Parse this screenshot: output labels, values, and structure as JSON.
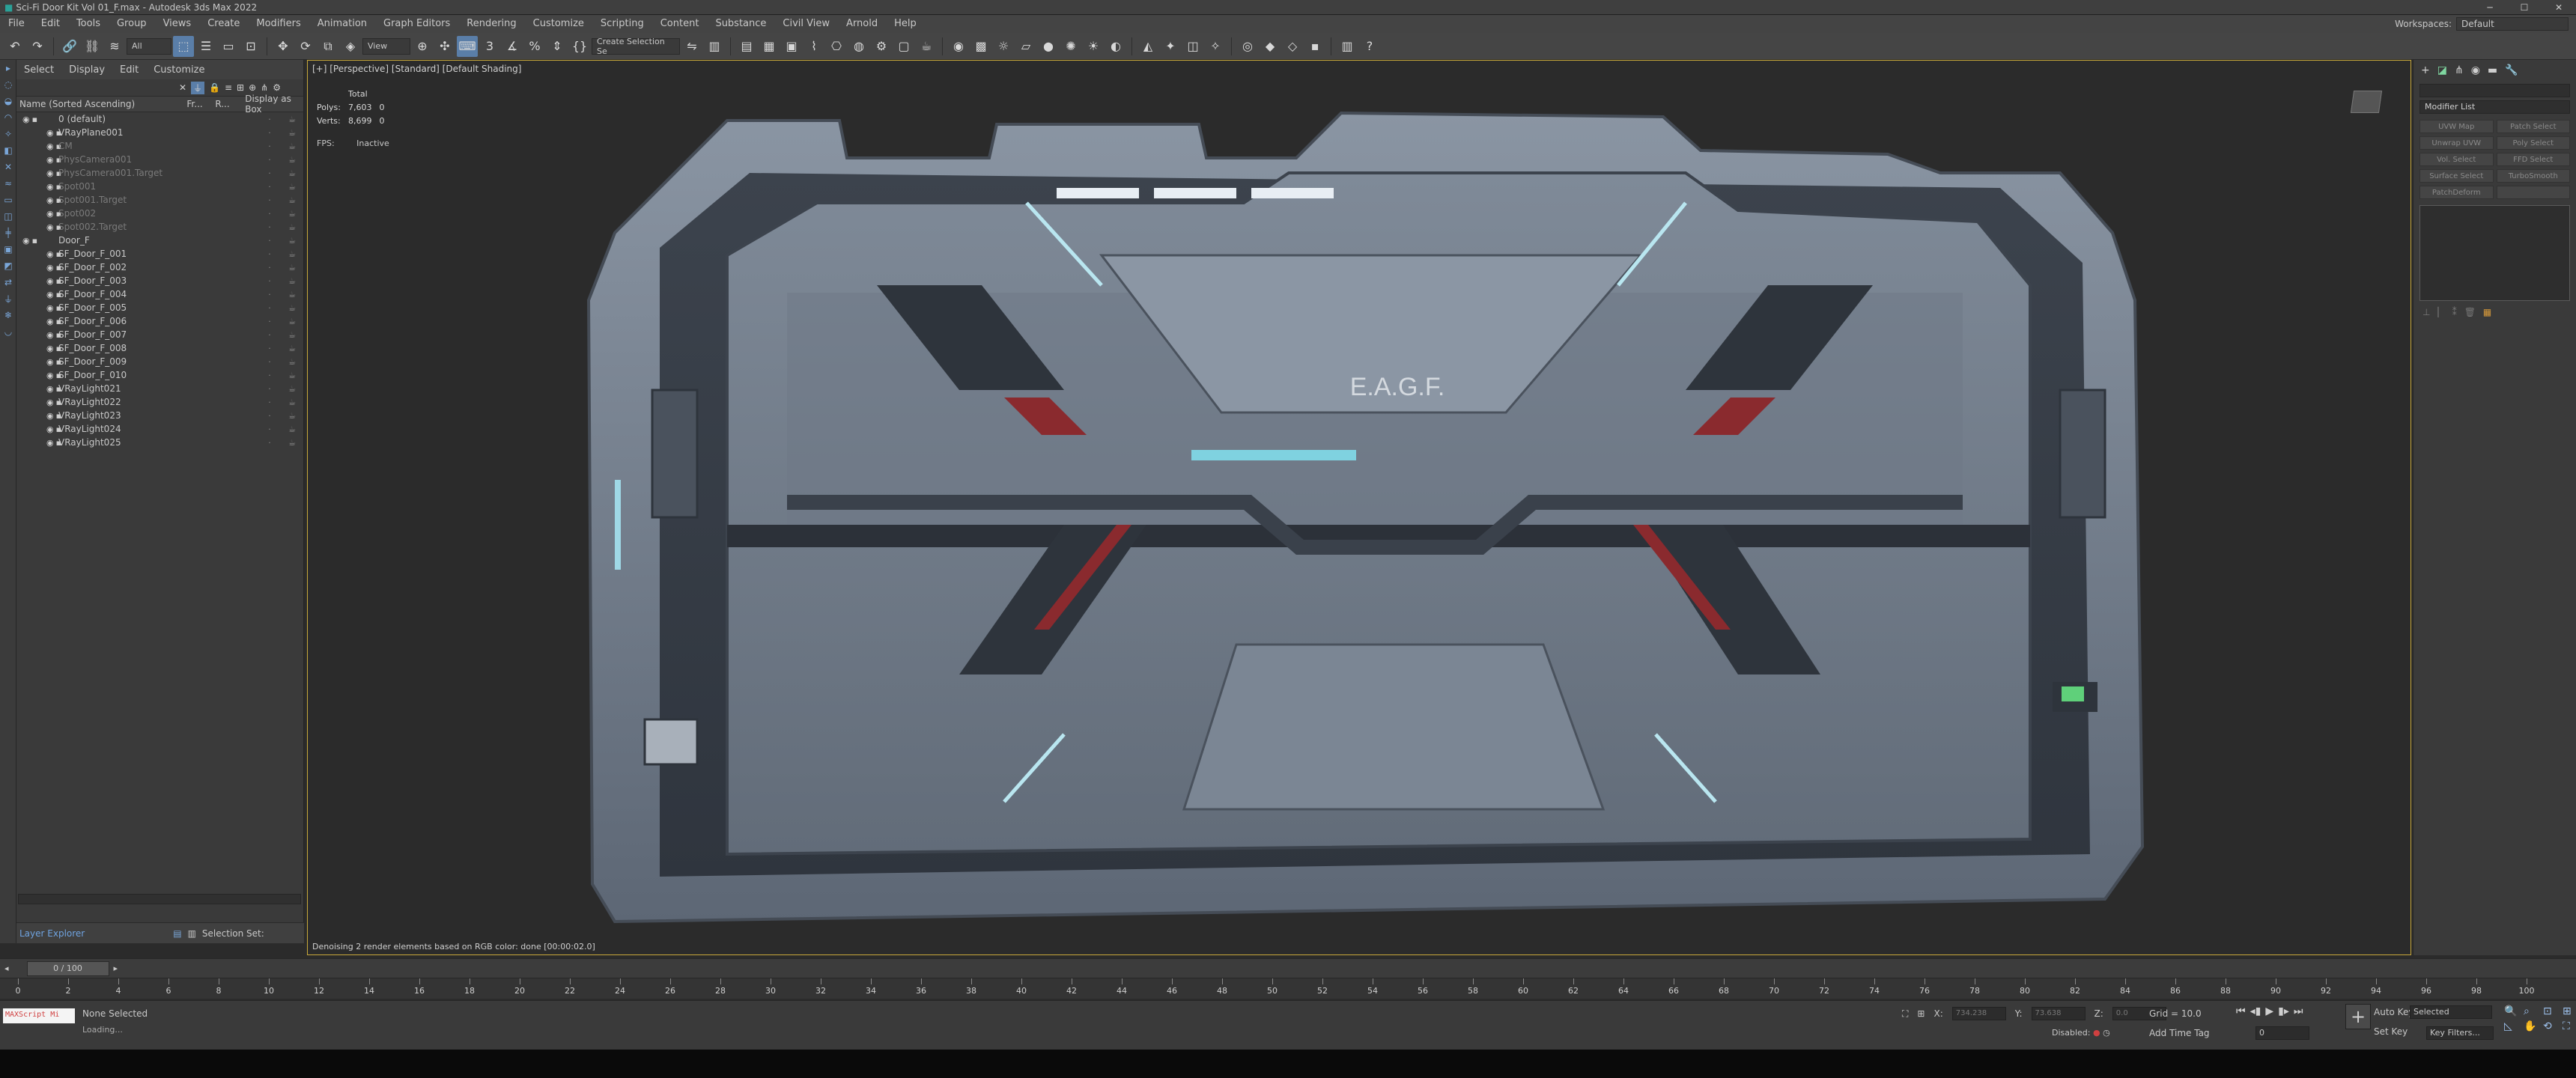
{
  "window": {
    "title": "Sci-Fi Door Kit Vol 01_F.max - Autodesk 3ds Max 2022"
  },
  "menu": [
    "File",
    "Edit",
    "Tools",
    "Group",
    "Views",
    "Create",
    "Modifiers",
    "Animation",
    "Graph Editors",
    "Rendering",
    "Customize",
    "Scripting",
    "Content",
    "Substance",
    "Civil View",
    "Arnold",
    "Help"
  ],
  "workspace": {
    "label": "Workspaces:",
    "value": "Default"
  },
  "toolbar": {
    "filter": "All",
    "view": "View",
    "selection_set": "Create Selection Se"
  },
  "explorer": {
    "tabs": [
      "Select",
      "Display",
      "Edit",
      "Customize"
    ],
    "columns": [
      "Name (Sorted Ascending)",
      "Fr...",
      "R...",
      "Display as Box"
    ],
    "rows": [
      {
        "label": "0 (default)",
        "dim": false
      },
      {
        "label": "VRayPlane001",
        "dim": false
      },
      {
        "label": "CM",
        "dim": true
      },
      {
        "label": "PhysCamera001",
        "dim": true
      },
      {
        "label": "PhysCamera001.Target",
        "dim": true
      },
      {
        "label": "Spot001",
        "dim": true
      },
      {
        "label": "Spot001.Target",
        "dim": true
      },
      {
        "label": "Spot002",
        "dim": true
      },
      {
        "label": "Spot002.Target",
        "dim": true
      },
      {
        "label": "Door_F",
        "dim": false
      },
      {
        "label": "SF_Door_F_001",
        "dim": false
      },
      {
        "label": "SF_Door_F_002",
        "dim": false
      },
      {
        "label": "SF_Door_F_003",
        "dim": false
      },
      {
        "label": "SF_Door_F_004",
        "dim": false
      },
      {
        "label": "SF_Door_F_005",
        "dim": false
      },
      {
        "label": "SF_Door_F_006",
        "dim": false
      },
      {
        "label": "SF_Door_F_007",
        "dim": false
      },
      {
        "label": "SF_Door_F_008",
        "dim": false
      },
      {
        "label": "SF_Door_F_009",
        "dim": false
      },
      {
        "label": "SF_Door_F_010",
        "dim": false
      },
      {
        "label": "VRayLight021",
        "dim": false
      },
      {
        "label": "VRayLight022",
        "dim": false
      },
      {
        "label": "VRayLight023",
        "dim": false
      },
      {
        "label": "VRayLight024",
        "dim": false
      },
      {
        "label": "VRayLight025",
        "dim": false
      }
    ],
    "footer": {
      "layer": "Layer Explorer",
      "selset": "Selection Set:"
    }
  },
  "viewport": {
    "label": "[+] [Perspective] [Standard] [Default Shading]",
    "stats": {
      "header": "Total",
      "polys_label": "Polys:",
      "polys": "7,603",
      "polys_sel": "0",
      "verts_label": "Verts:",
      "verts": "8,699",
      "verts_sel": "0"
    },
    "fps_label": "FPS:",
    "fps": "Inactive",
    "status": "Denoising 2 render elements based on RGB color: done [00:00:02.0]",
    "decal_main": "E.A.G.F."
  },
  "command_panel": {
    "modifier_list": "Modifier List",
    "buttons": [
      "UVW Map",
      "Patch Select",
      "Unwrap UVW",
      "Poly Select",
      "Vol. Select",
      "FFD Select",
      "Surface Select",
      "TurboSmooth",
      "PatchDeform",
      ""
    ]
  },
  "timeline": {
    "slider": "0 / 100",
    "ticks": [
      0,
      2,
      4,
      6,
      8,
      10,
      12,
      14,
      16,
      18,
      20,
      22,
      24,
      26,
      28,
      30,
      32,
      34,
      36,
      38,
      40,
      42,
      44,
      46,
      48,
      50,
      52,
      54,
      56,
      58,
      60,
      62,
      64,
      66,
      68,
      70,
      72,
      74,
      76,
      78,
      80,
      82,
      84,
      86,
      88,
      90,
      92,
      94,
      96,
      98,
      100
    ]
  },
  "status": {
    "maxscript": "MAXScript Mi",
    "selected": "None Selected",
    "loading": "Loading...",
    "x_label": "X:",
    "x": "734.238",
    "y_label": "Y:",
    "y": "73.638",
    "z_label": "Z:",
    "z": "0.0",
    "grid": "Grid = 10.0",
    "addtag": "Add Time Tag",
    "disabled": "Disabled:",
    "autokey": "Auto Key",
    "setkey": "Set Key",
    "selected_drop": "Selected",
    "keyfilters": "Key Filters...",
    "frame": "0"
  }
}
